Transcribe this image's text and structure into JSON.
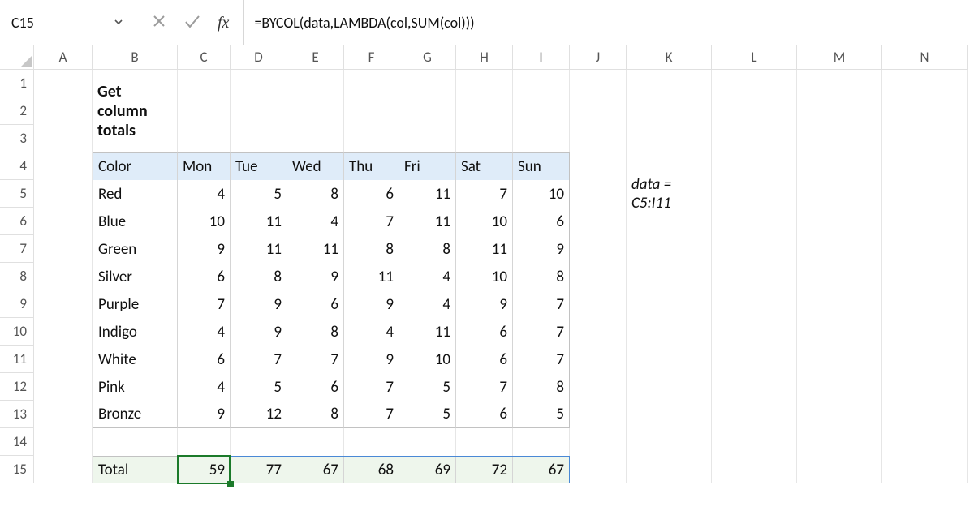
{
  "namebox": {
    "value": "C15"
  },
  "formula": "=BYCOL(data,LAMBDA(col,SUM(col)))",
  "fx_label": "fx",
  "columns": [
    "A",
    "B",
    "C",
    "D",
    "E",
    "F",
    "G",
    "H",
    "I",
    "J",
    "K",
    "L",
    "M",
    "N"
  ],
  "rows": [
    "1",
    "2",
    "3",
    "4",
    "5",
    "6",
    "7",
    "8",
    "9",
    "10",
    "11",
    "12",
    "13",
    "14",
    "15"
  ],
  "title": "Get column totals",
  "headers": {
    "color": "Color",
    "days": [
      "Mon",
      "Tue",
      "Wed",
      "Thu",
      "Fri",
      "Sat",
      "Sun"
    ]
  },
  "data_rows": [
    {
      "color": "Red",
      "vals": [
        4,
        5,
        8,
        6,
        11,
        7,
        10
      ]
    },
    {
      "color": "Blue",
      "vals": [
        10,
        11,
        4,
        7,
        11,
        10,
        6
      ]
    },
    {
      "color": "Green",
      "vals": [
        9,
        11,
        11,
        8,
        8,
        11,
        9
      ]
    },
    {
      "color": "Silver",
      "vals": [
        6,
        8,
        9,
        11,
        4,
        10,
        8
      ]
    },
    {
      "color": "Purple",
      "vals": [
        7,
        9,
        6,
        9,
        4,
        9,
        7
      ]
    },
    {
      "color": "Indigo",
      "vals": [
        4,
        9,
        8,
        4,
        11,
        6,
        7
      ]
    },
    {
      "color": "White",
      "vals": [
        6,
        7,
        7,
        9,
        10,
        6,
        7
      ]
    },
    {
      "color": "Pink",
      "vals": [
        4,
        5,
        6,
        7,
        5,
        7,
        8
      ]
    },
    {
      "color": "Bronze",
      "vals": [
        9,
        12,
        8,
        7,
        5,
        6,
        5
      ]
    }
  ],
  "total_label": "Total",
  "totals": [
    59,
    77,
    67,
    68,
    69,
    72,
    67
  ],
  "note": "data = C5:I11",
  "chart_data": {
    "type": "table",
    "title": "Get column totals",
    "columns": [
      "Color",
      "Mon",
      "Tue",
      "Wed",
      "Thu",
      "Fri",
      "Sat",
      "Sun"
    ],
    "rows": [
      [
        "Red",
        4,
        5,
        8,
        6,
        11,
        7,
        10
      ],
      [
        "Blue",
        10,
        11,
        4,
        7,
        11,
        10,
        6
      ],
      [
        "Green",
        9,
        11,
        11,
        8,
        8,
        11,
        9
      ],
      [
        "Silver",
        6,
        8,
        9,
        11,
        4,
        10,
        8
      ],
      [
        "Purple",
        7,
        9,
        6,
        9,
        4,
        9,
        7
      ],
      [
        "Indigo",
        4,
        9,
        8,
        4,
        11,
        6,
        7
      ],
      [
        "White",
        6,
        7,
        7,
        9,
        10,
        6,
        7
      ],
      [
        "Pink",
        4,
        5,
        6,
        7,
        5,
        7,
        8
      ],
      [
        "Bronze",
        9,
        12,
        8,
        7,
        5,
        6,
        5
      ]
    ],
    "totals": [
      "Total",
      59,
      77,
      67,
      68,
      69,
      72,
      67
    ]
  }
}
